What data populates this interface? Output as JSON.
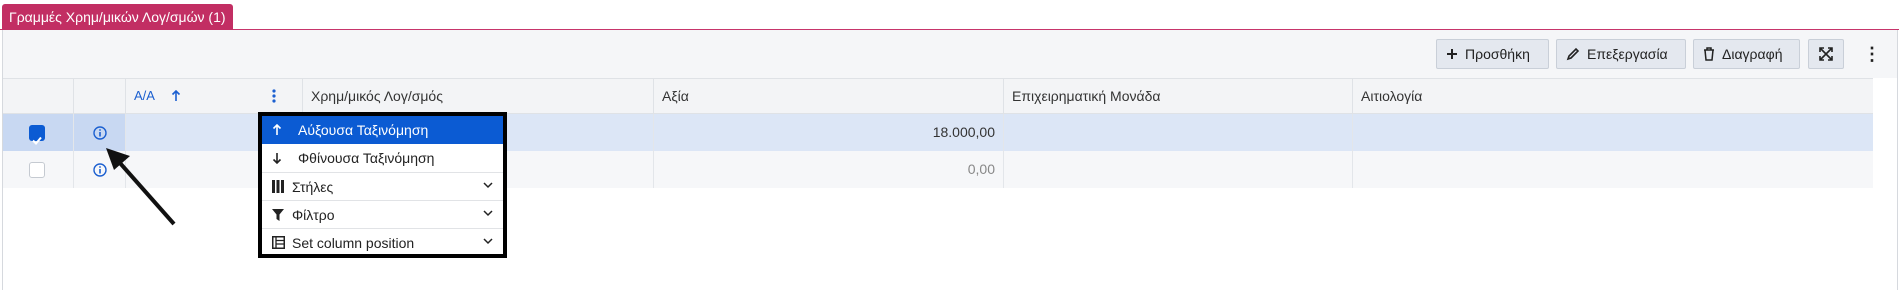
{
  "tab": {
    "label": "Γραμμές Χρημ/μικών Λογ/σμών (1)"
  },
  "toolbar": {
    "add_label": "Προσθήκη",
    "edit_label": "Επεξεργασία",
    "delete_label": "Διαγραφή",
    "more_label": "⋮"
  },
  "colors": {
    "accent": "#c22e63",
    "selection": "#0b5bd3",
    "row_selected": "#dce6f6"
  },
  "table": {
    "columns": [
      "Α/Α",
      "Χρημ/μικός Λογ/σμός",
      "Αξία",
      "Επιχειρηματική Μονάδα",
      "Αιτιολογία"
    ],
    "rows": [
      {
        "selected": true,
        "aa": "",
        "account": "",
        "value": "18.000,00",
        "business_unit": "",
        "reason": ""
      },
      {
        "selected": false,
        "aa": "",
        "account": "",
        "value": "0,00",
        "business_unit": "",
        "reason": ""
      }
    ]
  },
  "column_menu": {
    "items": [
      {
        "label": "Αύξουσα Ταξινόμηση",
        "icon": "arrow-up-icon",
        "active": true
      },
      {
        "label": "Φθίνουσα Ταξινόμηση",
        "icon": "arrow-down-icon",
        "active": false
      },
      {
        "label": "Στήλες",
        "icon": "columns-icon",
        "submenu": true
      },
      {
        "label": "Φίλτρο",
        "icon": "filter-icon",
        "submenu": true
      },
      {
        "label": "Set column position",
        "icon": "table-icon",
        "submenu": true
      }
    ]
  }
}
